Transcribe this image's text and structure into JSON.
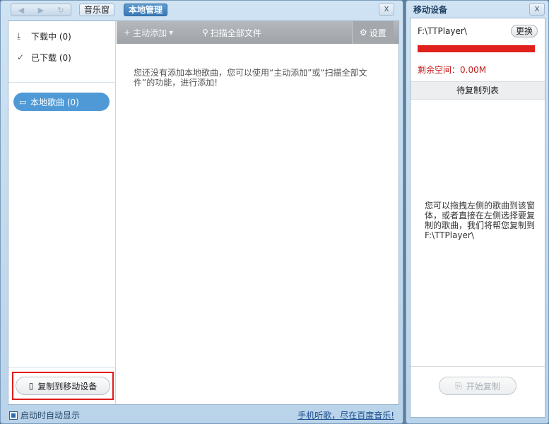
{
  "main": {
    "nav": {
      "back_icon": "arrow-left-icon",
      "forward_icon": "arrow-right-icon",
      "refresh_icon": "refresh-icon"
    },
    "tabs": [
      {
        "label": "音乐窗"
      },
      {
        "label": "本地管理"
      }
    ],
    "close_label": "x",
    "left_panel": {
      "downloading": "下载中 (0)",
      "downloaded": "已下载 (0)",
      "local_songs": "本地歌曲 (0)",
      "copy_to_device": "复制到移动设备"
    },
    "toolbar": {
      "add_label": "主动添加",
      "scan_label": "扫描全部文件",
      "settings_label": "设置"
    },
    "empty_message": "您还没有添加本地歌曲，您可以使用“主动添加”或“扫描全部文件”的功能，进行添加!"
  },
  "bottom": {
    "autostart_label": "启动时自动显示",
    "promo_link": "手机听歌，尽在百度音乐!"
  },
  "device": {
    "title": "移动设备",
    "close_label": "x",
    "path": "F:\\TTPlayer\\",
    "change_label": "更换",
    "space_label": "剩余空间：0.00M",
    "pending_header": "待复制列表",
    "pending_message": "您可以拖拽左侧的歌曲到该窗体，或者直接在左侧选择要复制的歌曲，我们将帮您复制到F:\\TTPlayer\\",
    "start_copy_label": "开始复制"
  },
  "colors": {
    "accent_blue": "#4f9ad6",
    "highlight_red": "#e01b1b",
    "space_bar_red": "#e0201c"
  }
}
